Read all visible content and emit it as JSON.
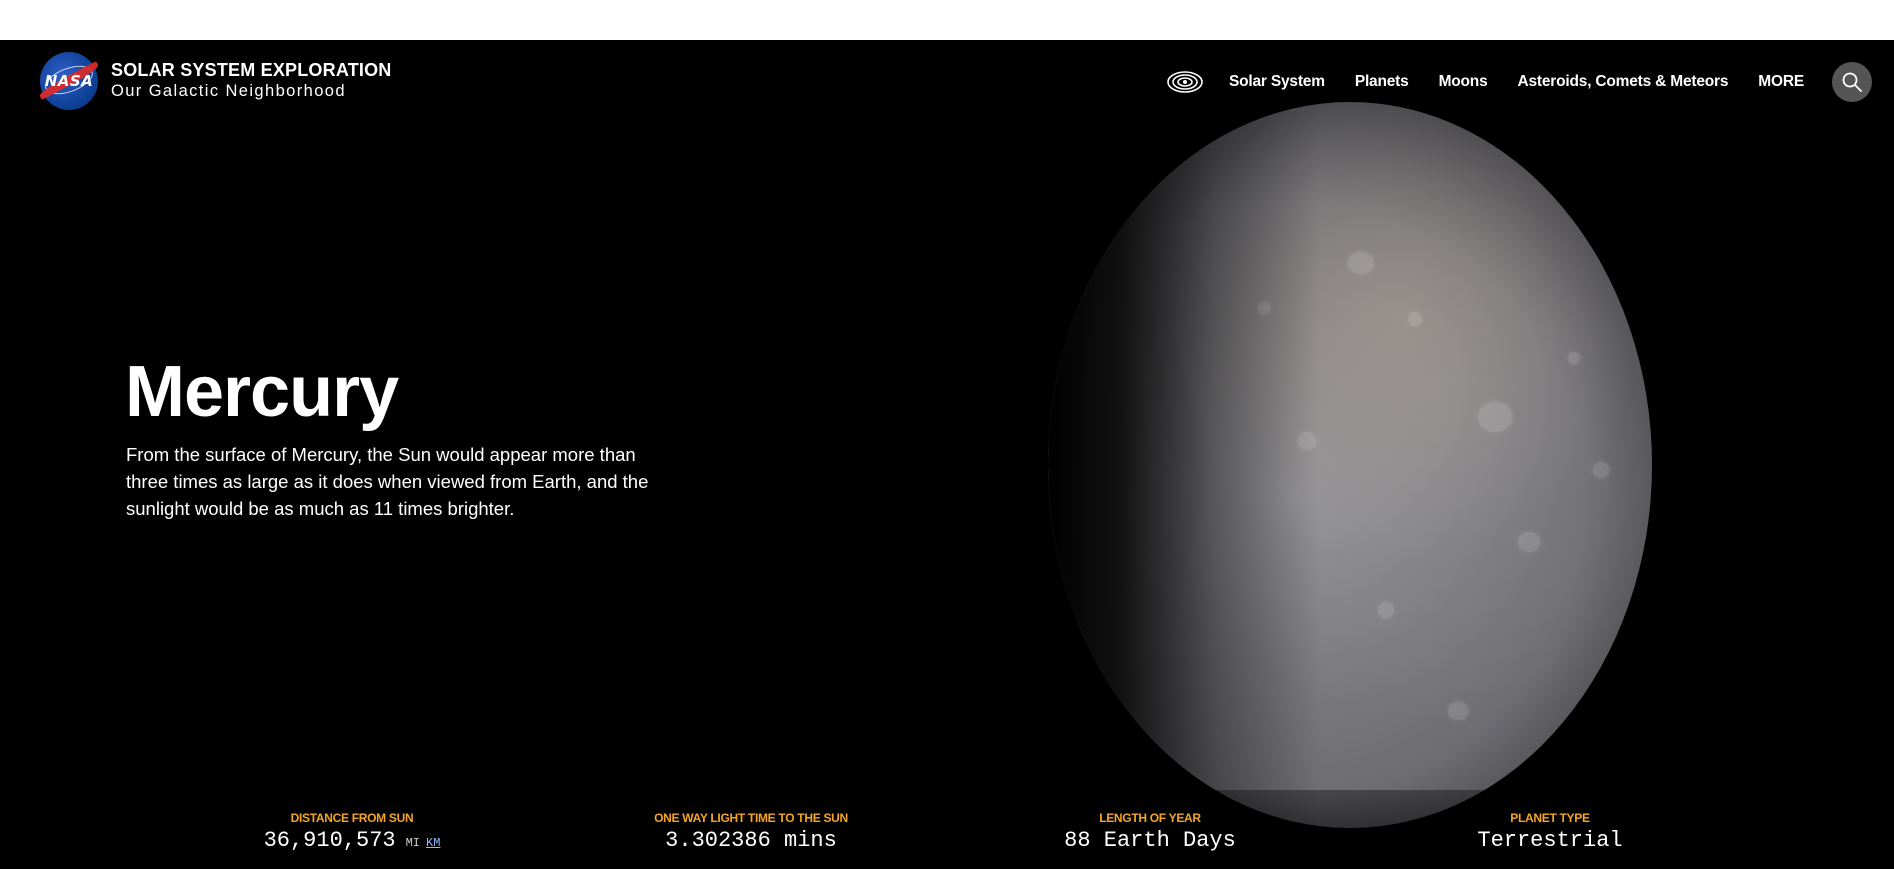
{
  "header": {
    "site_title": "SOLAR SYSTEM EXPLORATION",
    "site_subtitle": "Our Galactic Neighborhood",
    "logo_text": "NASA"
  },
  "nav": {
    "items": [
      "Solar System",
      "Planets",
      "Moons",
      "Asteroids, Comets & Meteors",
      "MORE"
    ]
  },
  "hero": {
    "title": "Mercury",
    "description": "From the surface of Mercury, the Sun would appear more than three times as large as it does when viewed from Earth, and the sunlight would be as much as 11 times brighter."
  },
  "stats": [
    {
      "label": "DISTANCE FROM SUN",
      "value": "36,910,573",
      "unit": "MI",
      "unit_alt": "KM"
    },
    {
      "label": "ONE WAY LIGHT TIME TO THE SUN",
      "value": "3.302386 mins"
    },
    {
      "label": "LENGTH OF YEAR",
      "value": "88 Earth Days"
    },
    {
      "label": "PLANET TYPE",
      "value": "Terrestrial"
    }
  ],
  "icons": {
    "logo": "nasa-meatball-icon",
    "nav": "solar-system-orbit-icon",
    "search": "search-icon"
  },
  "colors": {
    "background": "#000000",
    "stat_label": "#f5a623",
    "search_button": "#555555",
    "link": "#8fb8ff"
  }
}
